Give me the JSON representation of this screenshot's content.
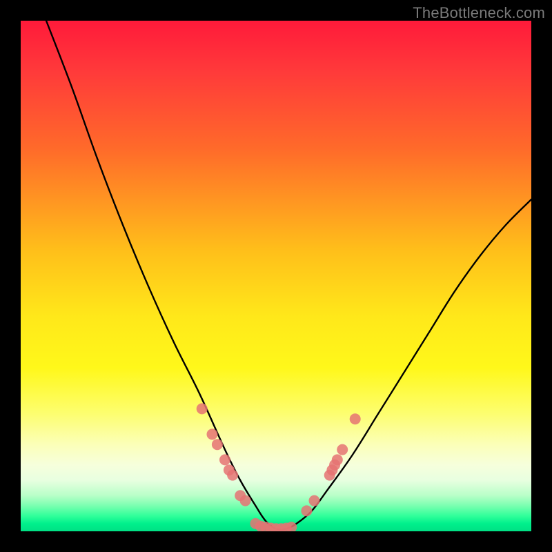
{
  "watermark": "TheBottleneck.com",
  "chart_data": {
    "type": "line",
    "title": "",
    "xlabel": "",
    "ylabel": "",
    "xlim": [
      0,
      100
    ],
    "ylim": [
      0,
      100
    ],
    "grid": false,
    "legend": false,
    "annotations": [],
    "comment": "V-shaped bottleneck curve on rainbow performance gradient. X is an implicit hardware-balance axis; Y is bottleneck severity (top=high/red, bottom=low/green). Curve reaches near-zero around x≈50. Pink dots mark sampled configurations near the trough.",
    "gradient_stops": [
      {
        "pos": 0.0,
        "color": "#ff1a3a",
        "meaning": "severe bottleneck"
      },
      {
        "pos": 0.45,
        "color": "#ffbf1a",
        "meaning": "moderate"
      },
      {
        "pos": 0.68,
        "color": "#fff81a",
        "meaning": "mild"
      },
      {
        "pos": 0.95,
        "color": "#7affb0",
        "meaning": "balanced"
      },
      {
        "pos": 1.0,
        "color": "#00e084",
        "meaning": "optimal"
      }
    ],
    "series": [
      {
        "name": "bottleneck-curve",
        "x": [
          5,
          10,
          15,
          20,
          25,
          30,
          35,
          40,
          43,
          46,
          48,
          50,
          52,
          54,
          57,
          60,
          65,
          70,
          75,
          80,
          85,
          90,
          95,
          100
        ],
        "y": [
          100,
          87,
          73,
          60,
          48,
          37,
          27,
          16,
          10,
          5,
          2,
          0.5,
          0.5,
          1.5,
          4,
          8,
          15,
          23,
          31,
          39,
          47,
          54,
          60,
          65
        ]
      }
    ],
    "points": [
      {
        "name": "sample",
        "x": 35.5,
        "y": 24
      },
      {
        "name": "sample",
        "x": 37.5,
        "y": 19
      },
      {
        "name": "sample",
        "x": 38.5,
        "y": 17
      },
      {
        "name": "sample",
        "x": 40.0,
        "y": 14
      },
      {
        "name": "sample",
        "x": 40.8,
        "y": 12
      },
      {
        "name": "sample",
        "x": 41.5,
        "y": 11
      },
      {
        "name": "sample",
        "x": 43.0,
        "y": 7
      },
      {
        "name": "sample",
        "x": 44.0,
        "y": 6
      },
      {
        "name": "sample",
        "x": 46.0,
        "y": 1.5
      },
      {
        "name": "sample",
        "x": 47.0,
        "y": 1.0
      },
      {
        "name": "sample",
        "x": 48.0,
        "y": 0.8
      },
      {
        "name": "sample",
        "x": 49.0,
        "y": 0.6
      },
      {
        "name": "sample",
        "x": 50.0,
        "y": 0.5
      },
      {
        "name": "sample",
        "x": 51.0,
        "y": 0.5
      },
      {
        "name": "sample",
        "x": 52.0,
        "y": 0.6
      },
      {
        "name": "sample",
        "x": 53.0,
        "y": 0.8
      },
      {
        "name": "sample",
        "x": 56.0,
        "y": 4
      },
      {
        "name": "sample",
        "x": 57.5,
        "y": 6
      },
      {
        "name": "sample",
        "x": 60.5,
        "y": 11
      },
      {
        "name": "sample",
        "x": 61.0,
        "y": 12
      },
      {
        "name": "sample",
        "x": 61.5,
        "y": 13
      },
      {
        "name": "sample",
        "x": 62.0,
        "y": 14
      },
      {
        "name": "sample",
        "x": 63.0,
        "y": 16
      },
      {
        "name": "sample",
        "x": 65.5,
        "y": 22
      }
    ]
  }
}
